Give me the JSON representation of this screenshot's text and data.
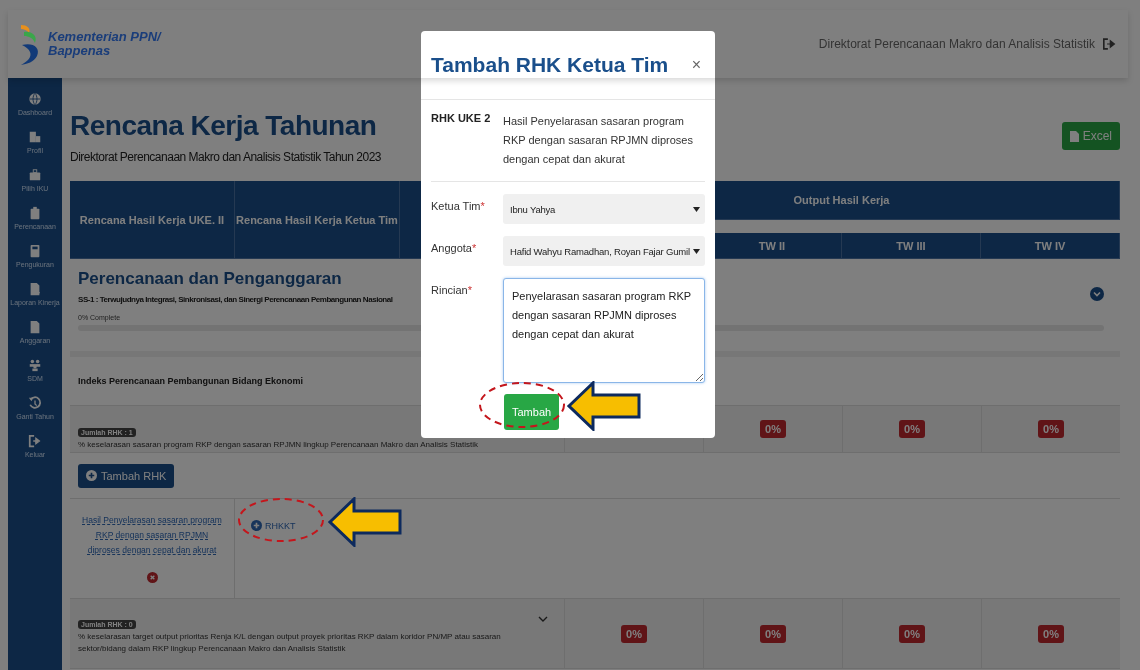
{
  "header": {
    "brand_lines": [
      "Kementerian PPN/",
      "Bappenas"
    ],
    "user": "Direktorat Perencanaan Makro dan Analisis Statistik"
  },
  "sidebar": {
    "items": [
      {
        "label": "Dashboard"
      },
      {
        "label": "Profil"
      },
      {
        "label": "Pilih IKU"
      },
      {
        "label": "Perencanaan"
      },
      {
        "label": "Pengukuran"
      },
      {
        "label": "Laporan Kinerja"
      },
      {
        "label": "Anggaran"
      },
      {
        "label": "SDM"
      },
      {
        "label": "Ganti Tahun"
      },
      {
        "label": "Keluar"
      }
    ]
  },
  "page": {
    "title": "Rencana Kerja Tahunan",
    "subtitle": "Direktorat Perencanaan Makro dan Analisis Statistik Tahun 2023",
    "export_button": "Excel"
  },
  "table": {
    "columns": [
      "Rencana Hasil Kerja UKE. II",
      "Rencana Hasil Kerja Ketua Tim"
    ],
    "group_header": "Output Hasil Kerja",
    "quarters": [
      "TW II",
      "TW III",
      "TW IV"
    ]
  },
  "section": {
    "title": "Perencanaan dan Penganggaran",
    "subtitle": "SS-1 : Terwujudnya Integrasi, Sinkronisasi, dan Sinergi Perencanaan Pembangunan Nasional",
    "progress_label": "0% Complete",
    "level": 0,
    "expanded": false
  },
  "rows": [
    {
      "kind": "indicator_title",
      "text": "Indeks Perencanaan Pembangunan Bidang Ekonomi"
    },
    {
      "kind": "indicator",
      "count_badge": "Jumlah RHK : 1",
      "text": "% keselarasan sasaran program RKP dengan sasaran RPJMN lingkup Perencanaan Makro dan Analisis Statistik",
      "scores": [
        "0%",
        "0%",
        "0%"
      ],
      "expandable": false
    },
    {
      "kind": "add",
      "button": "Tambah RHK"
    },
    {
      "kind": "rhk",
      "link": "Hasil Penyelarasan sasaran program RKP dengan sasaran RPJMN diproses dengan cepat dan akurat",
      "child_link": "RHKKT"
    },
    {
      "kind": "indicator",
      "count_badge": "Jumlah RHK : 0",
      "text": "% keselarasan target output prioritas Renja K/L dengan output proyek prioritas RKP dalam koridor PN/MP atau sasaran sektor/bidang dalam RKP lingkup Perencanaan Makro dan Analisis Statistik",
      "scores": [
        "0%",
        "0%",
        "0%",
        "0%"
      ],
      "expandable": true
    }
  ],
  "modal": {
    "title": "Tambah RHK Ketua Tim",
    "close": "×",
    "rhk_label": "RHK UKE 2",
    "rhk_text": "Hasil Penyelarasan sasaran program RKP dengan sasaran RPJMN diproses dengan cepat dan akurat",
    "fields": [
      {
        "kind": "select",
        "label": "Ketua Tim",
        "required_mark": "*",
        "value": "Ibnu Yahya"
      },
      {
        "kind": "select",
        "label": "Anggota",
        "required_mark": "*",
        "value": "Hafid Wahyu Ramadhan, Royan Fajar Gumil"
      },
      {
        "kind": "textarea",
        "label": "Rincian",
        "required_mark": "*",
        "value": "Penyelarasan sasaran program RKP dengan sasaran RPJMN diproses dengan cepat dan akurat"
      }
    ],
    "submit": "Tambah"
  }
}
